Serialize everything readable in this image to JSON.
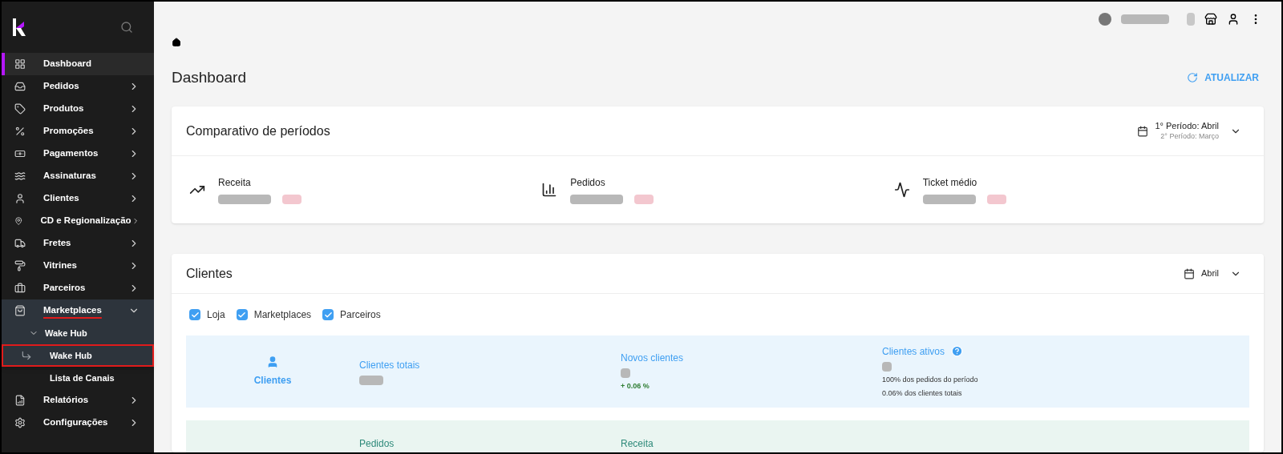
{
  "sidebar": {
    "items": [
      {
        "label": "Dashboard",
        "selected": true,
        "expandable": false
      },
      {
        "label": "Pedidos",
        "selected": false,
        "expandable": true
      },
      {
        "label": "Produtos",
        "selected": false,
        "expandable": true
      },
      {
        "label": "Promoções",
        "selected": false,
        "expandable": true
      },
      {
        "label": "Pagamentos",
        "selected": false,
        "expandable": true
      },
      {
        "label": "Assinaturas",
        "selected": false,
        "expandable": true
      },
      {
        "label": "Clientes",
        "selected": false,
        "expandable": true
      },
      {
        "label": "CD e Regionalização",
        "selected": false,
        "expandable": true
      },
      {
        "label": "Fretes",
        "selected": false,
        "expandable": true
      },
      {
        "label": "Vitrines",
        "selected": false,
        "expandable": true
      },
      {
        "label": "Parceiros",
        "selected": false,
        "expandable": true
      },
      {
        "label": "Marketplaces",
        "selected": false,
        "expandable": true,
        "expanded": true,
        "underlined": true,
        "children": [
          {
            "label": "Wake Hub",
            "expanded": true,
            "children": [
              {
                "label": "Wake Hub",
                "selected": true,
                "highlighted": true
              },
              {
                "label": "Lista de Canais",
                "selected": false,
                "highlighted": false
              }
            ]
          }
        ]
      },
      {
        "label": "Relatórios",
        "selected": false,
        "expandable": true
      },
      {
        "label": "Configurações",
        "selected": false,
        "expandable": true
      }
    ]
  },
  "page": {
    "title": "Dashboard",
    "refresh_button": "ATUALIZAR"
  },
  "comparison_card": {
    "title": "Comparativo de períodos",
    "period_1": "1° Período: Abril",
    "period_2": "2° Período: Março",
    "metrics": [
      {
        "label": "Receita"
      },
      {
        "label": "Pedidos"
      },
      {
        "label": "Ticket médio"
      }
    ]
  },
  "clients_card": {
    "title": "Clientes",
    "period": "Abril",
    "filters": [
      {
        "label": "Loja",
        "checked": true
      },
      {
        "label": "Marketplaces",
        "checked": true
      },
      {
        "label": "Parceiros",
        "checked": true
      }
    ],
    "summary": {
      "label": "Clientes",
      "stats": [
        {
          "label": "Clientes totais"
        },
        {
          "label": "Novos clientes",
          "change": "+ 0.06 %"
        },
        {
          "label": "Clientes ativos",
          "notes": [
            "100% dos pedidos do período",
            "0.06% dos clientes totais"
          ]
        }
      ]
    },
    "next_row": {
      "columns": [
        "Pedidos",
        "Receita"
      ]
    }
  }
}
